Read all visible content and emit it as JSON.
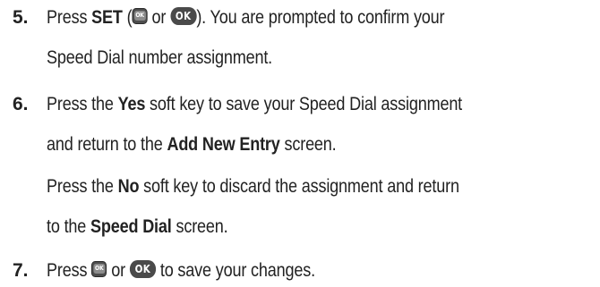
{
  "steps": [
    {
      "number": "5.",
      "line1": {
        "press": "Press ",
        "set": "SET",
        "open": " (",
        "or": " or ",
        "close": "). You are prompted to confirm your"
      },
      "line2": "Speed Dial number assignment."
    },
    {
      "number": "6.",
      "line1": {
        "press": "Press the ",
        "yes": "Yes",
        "rest": " soft key to save your Speed Dial assignment"
      },
      "line2": {
        "a": "and return to the ",
        "add_new_entry": "Add New Entry",
        "b": " screen."
      },
      "line3": {
        "press": "Press the ",
        "no": "No",
        "rest": " soft key to discard the assignment and return"
      },
      "line4": {
        "a": "to the ",
        "speed_dial": "Speed Dial",
        "b": " screen."
      }
    },
    {
      "number": "7.",
      "line1": {
        "press": "Press ",
        "or": " or ",
        "rest": " to save your changes."
      }
    }
  ],
  "keys": {
    "ok_square": "OK",
    "ok_pill": "OK"
  },
  "icons": {
    "ok_square": "ok-key-square-icon",
    "ok_pill": "ok-key-pill-icon"
  }
}
